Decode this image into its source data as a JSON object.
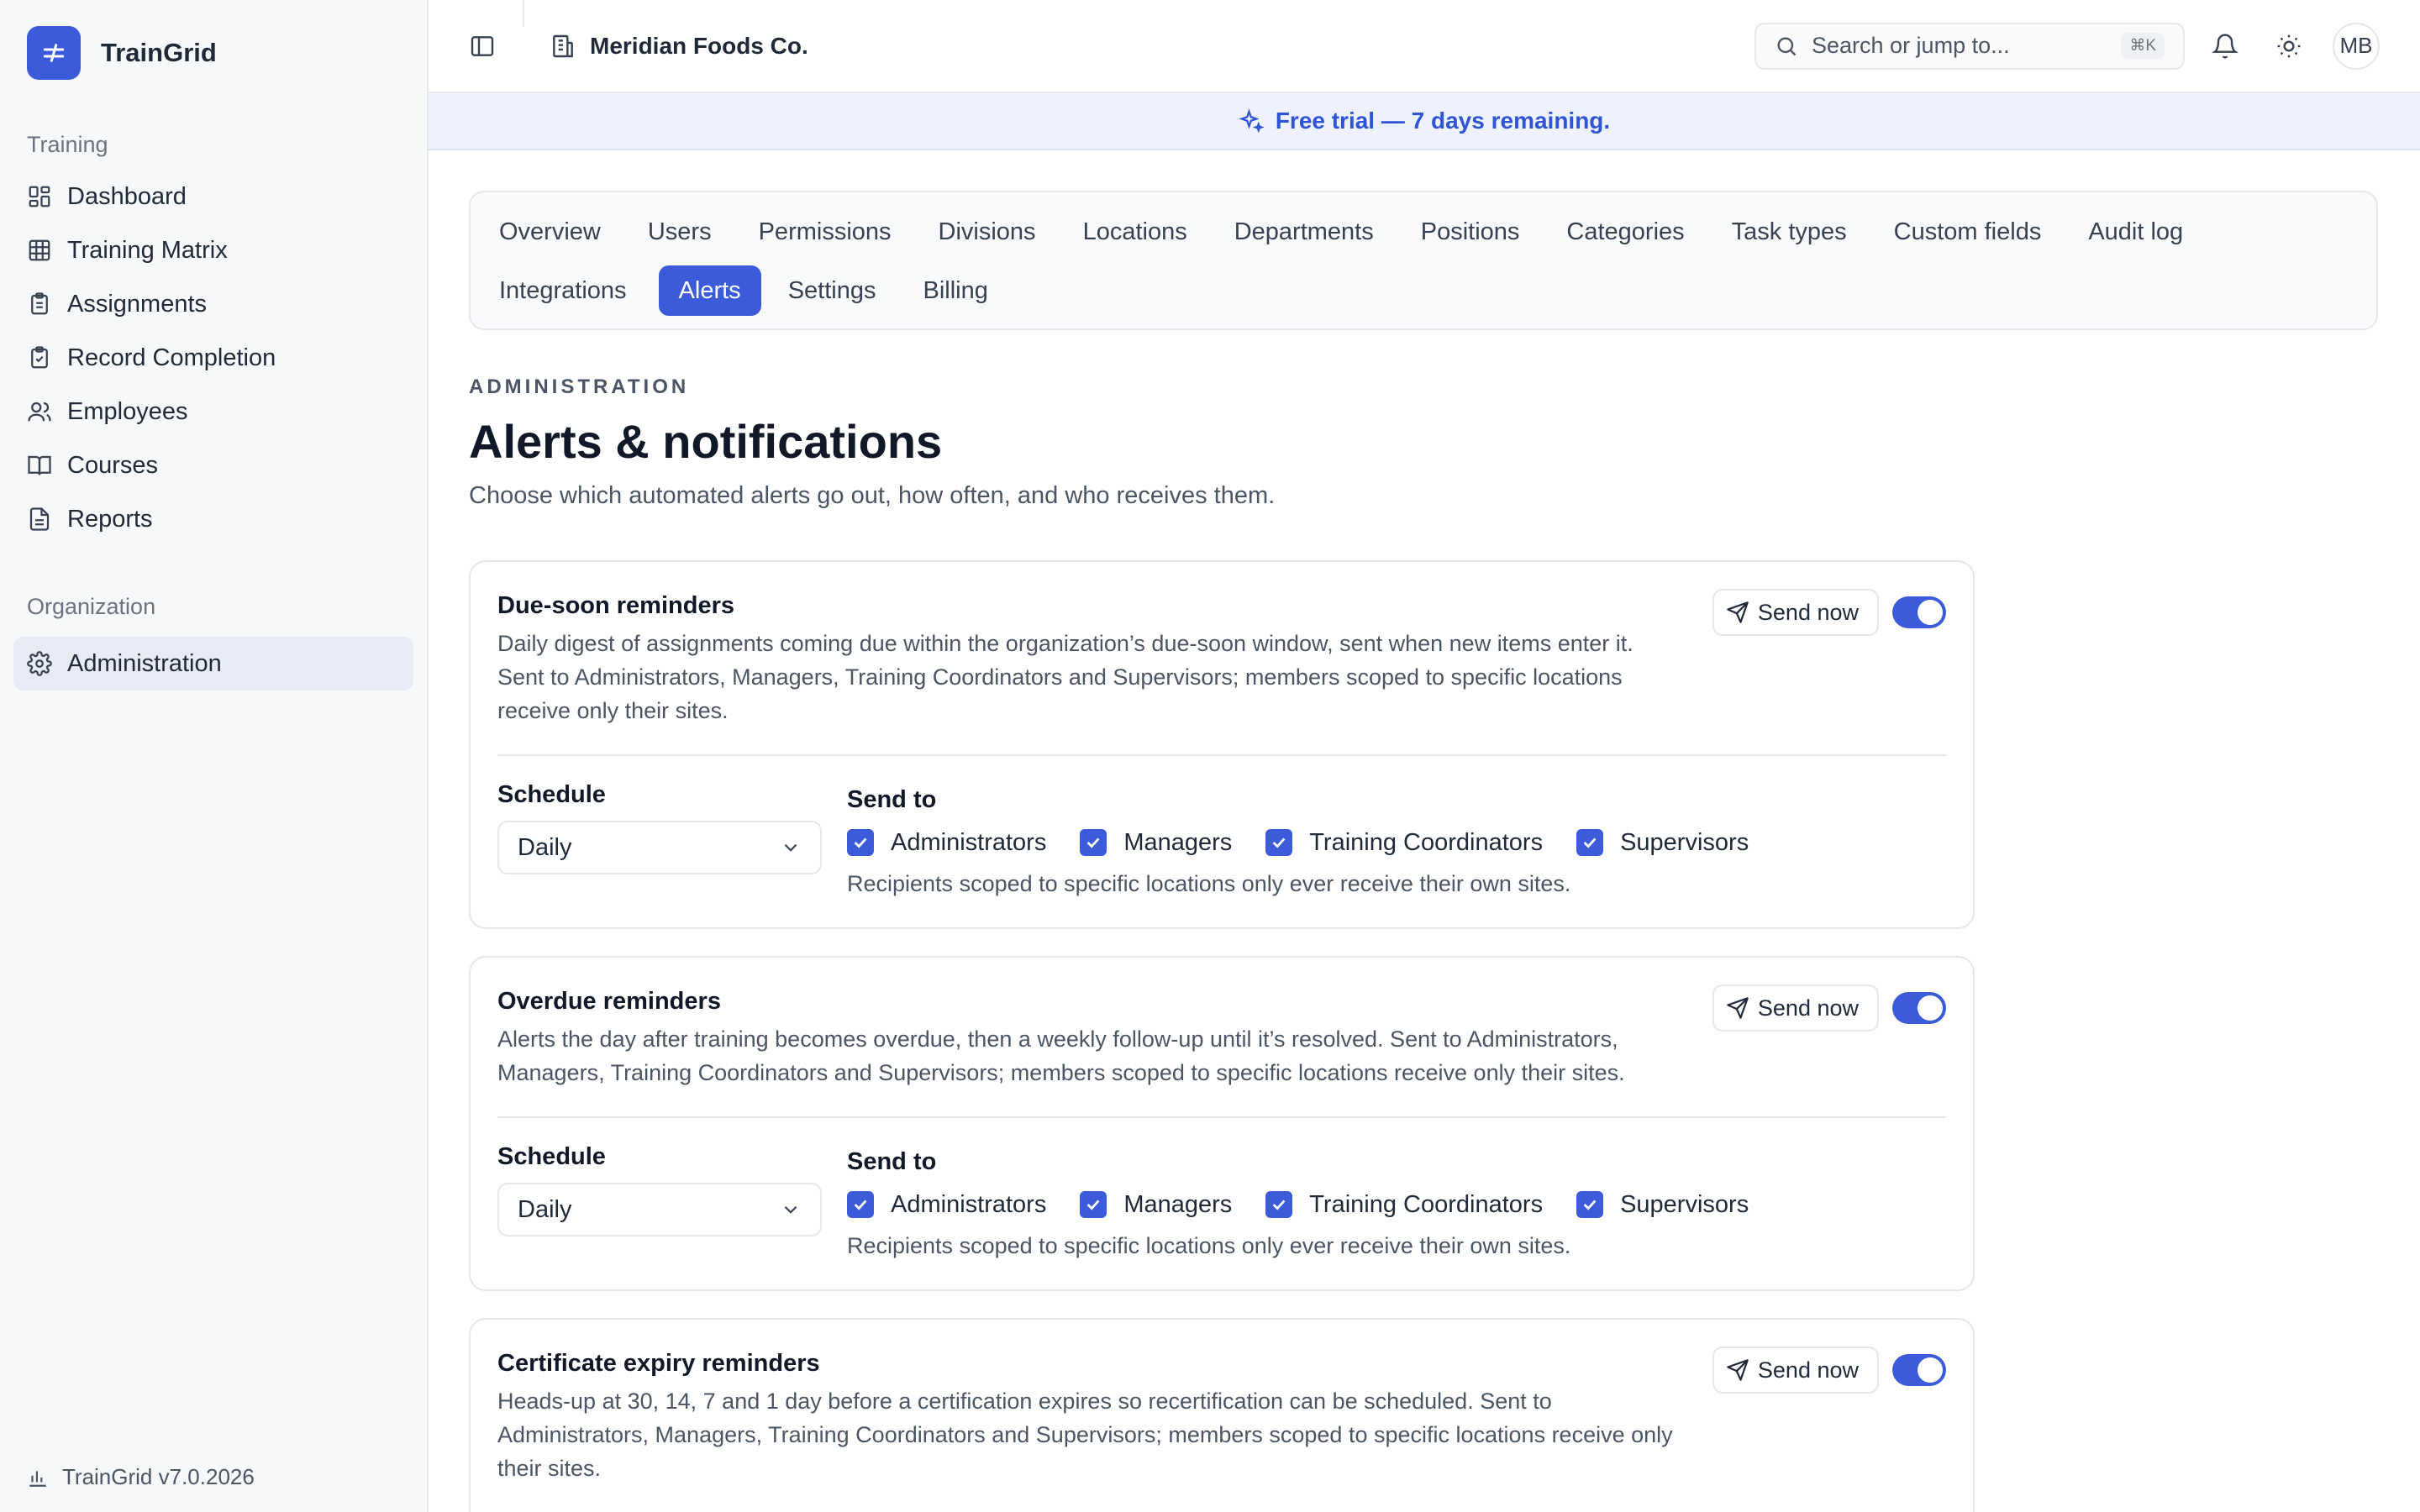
{
  "brand": {
    "name": "TrainGrid"
  },
  "sidebar": {
    "sections": [
      {
        "label": "Training",
        "items": [
          {
            "label": "Dashboard",
            "icon": "dashboard-icon"
          },
          {
            "label": "Training Matrix",
            "icon": "grid-icon"
          },
          {
            "label": "Assignments",
            "icon": "clipboard-list-icon"
          },
          {
            "label": "Record Completion",
            "icon": "clipboard-check-icon"
          },
          {
            "label": "Employees",
            "icon": "users-icon"
          },
          {
            "label": "Courses",
            "icon": "book-open-icon"
          },
          {
            "label": "Reports",
            "icon": "file-text-icon"
          }
        ]
      },
      {
        "label": "Organization",
        "items": [
          {
            "label": "Administration",
            "icon": "gear-icon",
            "active": true
          }
        ]
      }
    ],
    "footer": "TrainGrid v7.0.2026"
  },
  "topbar": {
    "org_name": "Meridian Foods Co.",
    "search_placeholder": "Search or jump to...",
    "search_shortcut": "⌘K",
    "avatar_initials": "MB"
  },
  "banner": {
    "text": "Free trial — 7 days remaining."
  },
  "tabs": {
    "row1": [
      "Overview",
      "Users",
      "Permissions",
      "Divisions",
      "Locations",
      "Departments",
      "Positions",
      "Categories",
      "Task types",
      "Custom fields",
      "Audit log"
    ],
    "row2": [
      "Integrations",
      "Alerts",
      "Settings",
      "Billing"
    ],
    "active": "Alerts"
  },
  "page": {
    "eyebrow": "ADMINISTRATION",
    "title": "Alerts & notifications",
    "subtitle": "Choose which automated alerts go out, how often, and who receives them."
  },
  "common": {
    "send_now": "Send now",
    "schedule_label": "Schedule",
    "send_to_label": "Send to",
    "recipients_hint": "Recipients scoped to specific locations only ever receive their own sites.",
    "accent_color": "#3b5bdb"
  },
  "alerts": [
    {
      "title": "Due-soon reminders",
      "description": "Daily digest of assignments coming due within the organization’s due-soon window, sent when new items enter it. Sent to Administrators, Managers, Training Coordinators and Supervisors; members scoped to specific locations receive only their sites.",
      "enabled": true,
      "schedule": "Daily",
      "recipients": [
        {
          "label": "Administrators",
          "checked": true
        },
        {
          "label": "Managers",
          "checked": true
        },
        {
          "label": "Training Coordinators",
          "checked": true
        },
        {
          "label": "Supervisors",
          "checked": true
        }
      ]
    },
    {
      "title": "Overdue reminders",
      "description": "Alerts the day after training becomes overdue, then a weekly follow-up until it’s resolved. Sent to Administrators, Managers, Training Coordinators and Supervisors; members scoped to specific locations receive only their sites.",
      "enabled": true,
      "schedule": "Daily",
      "recipients": [
        {
          "label": "Administrators",
          "checked": true
        },
        {
          "label": "Managers",
          "checked": true
        },
        {
          "label": "Training Coordinators",
          "checked": true
        },
        {
          "label": "Supervisors",
          "checked": true
        }
      ]
    },
    {
      "title": "Certificate expiry reminders",
      "description": "Heads-up at 30, 14, 7 and 1 day before a certification expires so recertification can be scheduled. Sent to Administrators, Managers, Training Coordinators and Supervisors; members scoped to specific locations receive only their sites.",
      "enabled": true
    }
  ]
}
